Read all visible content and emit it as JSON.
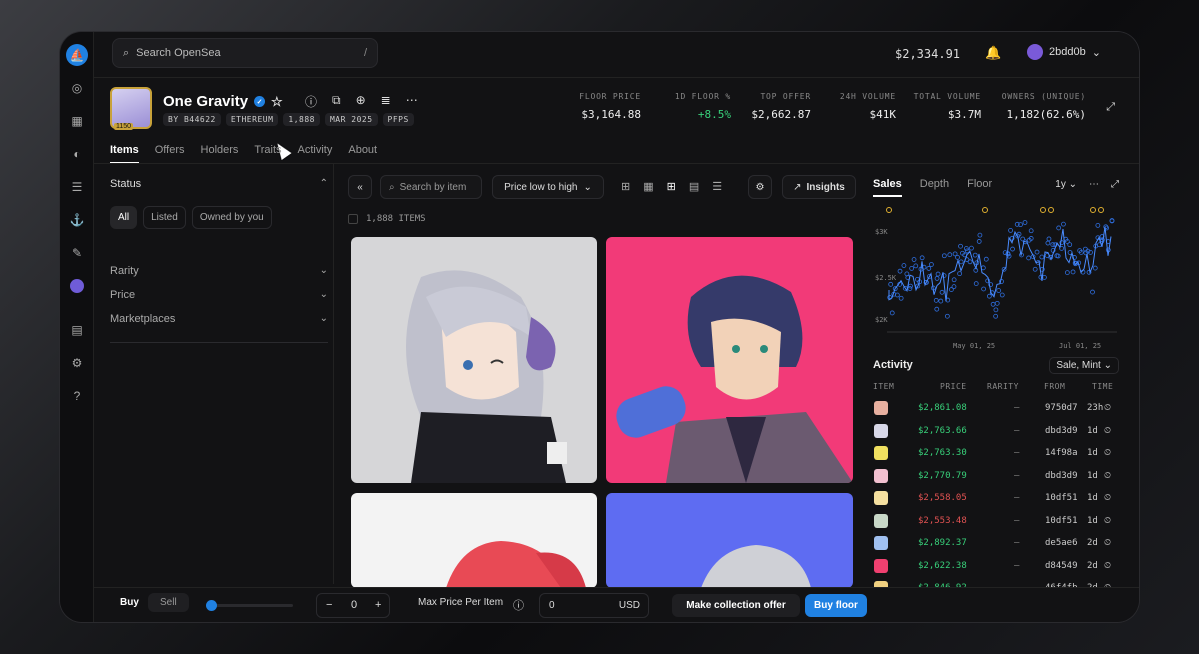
{
  "topbar": {
    "search_placeholder": "Search OpenSea",
    "search_shortcut": "/",
    "balance": "$2,334.91",
    "account": "2bdd0b"
  },
  "collection": {
    "name": "One Gravity",
    "rank_badge": "1150",
    "chips": [
      "BY B44622",
      "ETHEREUM",
      "1,888",
      "MAR 2025",
      "PFPS"
    ]
  },
  "stats": [
    {
      "label": "FLOOR PRICE",
      "value": "$3,164.88",
      "color": "#eeeeee"
    },
    {
      "label": "1D FLOOR %",
      "value": "+8.5%",
      "color": "#38d07a"
    },
    {
      "label": "TOP OFFER",
      "value": "$2,662.87",
      "color": "#eeeeee"
    },
    {
      "label": "24H VOLUME",
      "value": "$41K",
      "color": "#eeeeee"
    },
    {
      "label": "TOTAL VOLUME",
      "value": "$3.7M",
      "color": "#eeeeee"
    },
    {
      "label": "OWNERS (UNIQUE)",
      "value": "1,182(62.6%)",
      "color": "#eeeeee"
    }
  ],
  "tabs": [
    "Items",
    "Offers",
    "Holders",
    "Traits",
    "Activity",
    "About"
  ],
  "sidebar": {
    "status_label": "Status",
    "status_options": [
      "All",
      "Listed",
      "Owned by you"
    ],
    "filters": [
      "Rarity",
      "Price",
      "Marketplaces"
    ]
  },
  "toolbar": {
    "search_placeholder": "Search by item",
    "sort": "Price low to high",
    "insights": "Insights",
    "item_count": "1,888 ITEMS"
  },
  "chart": {
    "tabs": [
      "Sales",
      "Depth",
      "Floor"
    ],
    "range": "1y",
    "y_labels": [
      "$3K",
      "$2.5K",
      "$2K"
    ],
    "x_labels": [
      "May 01, 25",
      "Jul 01, 25"
    ]
  },
  "activity": {
    "title": "Activity",
    "filter": "Sale, Mint",
    "headers": [
      "ITEM",
      "PRICE",
      "RARITY",
      "FROM",
      "TIME"
    ],
    "rows": [
      {
        "price": "$2,861.08",
        "rarity": "–",
        "from": "9750d7",
        "time": "23h",
        "color": "#38d07a",
        "thumb": "#e8b0a0"
      },
      {
        "price": "$2,763.66",
        "rarity": "–",
        "from": "dbd3d9",
        "time": "1d",
        "color": "#38d07a",
        "thumb": "#d8d8e8"
      },
      {
        "price": "$2,763.30",
        "rarity": "–",
        "from": "14f98a",
        "time": "1d",
        "color": "#38d07a",
        "thumb": "#f0e060"
      },
      {
        "price": "$2,770.79",
        "rarity": "–",
        "from": "dbd3d9",
        "time": "1d",
        "color": "#38d07a",
        "thumb": "#f2c0d0"
      },
      {
        "price": "$2,558.05",
        "rarity": "–",
        "from": "10df51",
        "time": "1d",
        "color": "#e05252",
        "thumb": "#f5e0a0"
      },
      {
        "price": "$2,553.48",
        "rarity": "–",
        "from": "10df51",
        "time": "1d",
        "color": "#e05252",
        "thumb": "#c8d8c8"
      },
      {
        "price": "$2,892.37",
        "rarity": "–",
        "from": "de5ae6",
        "time": "2d",
        "color": "#38d07a",
        "thumb": "#a0c0f0"
      },
      {
        "price": "$2,622.38",
        "rarity": "–",
        "from": "d84549",
        "time": "2d",
        "color": "#38d07a",
        "thumb": "#f04070"
      },
      {
        "price": "$2,846.92",
        "rarity": "–",
        "from": "46f4fb",
        "time": "2d",
        "color": "#38d07a",
        "thumb": "#f0d080"
      }
    ]
  },
  "bottom": {
    "buy": "Buy",
    "sell": "Sell",
    "qty": "0",
    "max_price_label": "Max Price Per Item",
    "max_price_value": "0",
    "currency": "USD",
    "offer_button": "Make collection offer",
    "buy_button": "Buy floor"
  }
}
